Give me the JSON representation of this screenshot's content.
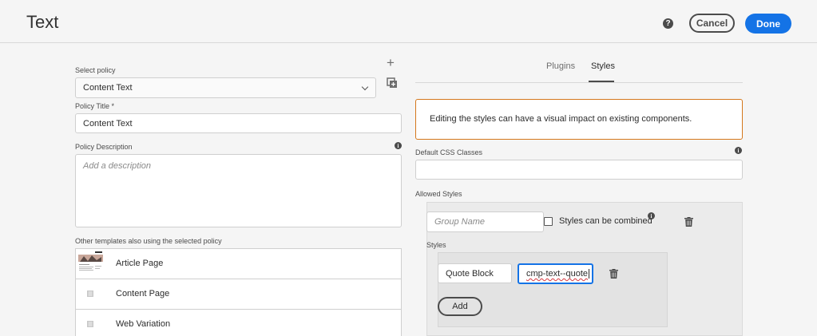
{
  "header": {
    "title": "Text",
    "help_icon": "?",
    "cancel_label": "Cancel",
    "done_label": "Done"
  },
  "left": {
    "select_policy_label": "Select policy",
    "select_policy_value": "Content Text",
    "policy_title_label": "Policy Title *",
    "policy_title_value": "Content Text",
    "policy_description_label": "Policy Description",
    "policy_description_placeholder": "Add a description",
    "other_templates_label": "Other templates also using the selected policy",
    "templates": [
      {
        "name": "Article Page"
      },
      {
        "name": "Content Page"
      },
      {
        "name": "Web Variation"
      }
    ]
  },
  "right": {
    "tabs": [
      {
        "label": "Plugins",
        "active": false
      },
      {
        "label": "Styles",
        "active": true
      }
    ],
    "alert_text": "Editing the styles can have a visual impact on existing components.",
    "default_css_label": "Default CSS Classes",
    "default_css_value": "",
    "allowed_styles_label": "Allowed Styles",
    "group_name_placeholder": "Group Name",
    "styles_combined_label": "Styles can be combined",
    "styles_label": "Styles",
    "style_name_value": "Quote Block",
    "style_class_value": "cmp-text--quote",
    "add_label": "Add"
  },
  "colors": {
    "accent": "#1473e6",
    "alert_border": "#d4771b"
  }
}
